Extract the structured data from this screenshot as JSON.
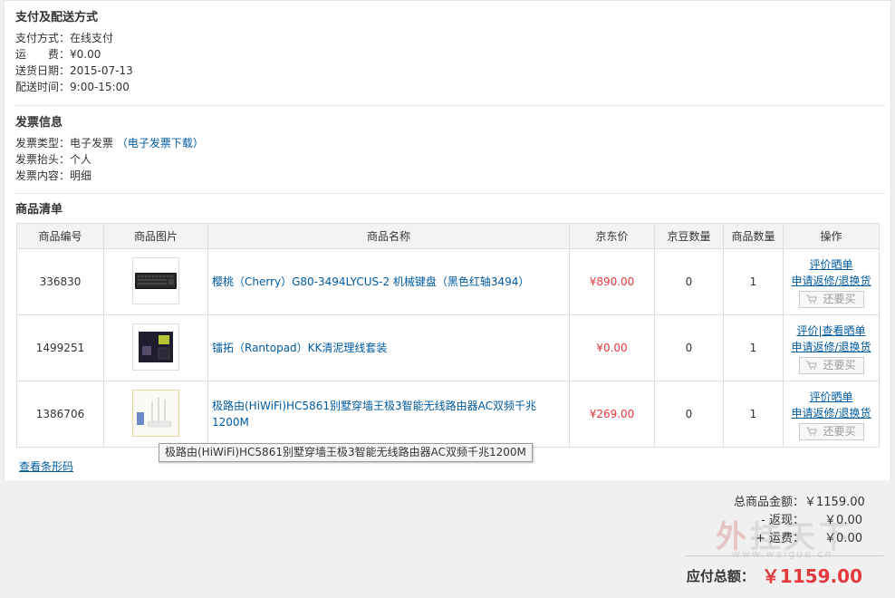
{
  "payment": {
    "title": "支付及配送方式",
    "method_label": "支付方式：",
    "method_value": "在线支付",
    "freight_label": "运　　费：",
    "freight_value": "¥0.00",
    "date_label": "送货日期：",
    "date_value": "2015-07-13",
    "time_label": "配送时间：",
    "time_value": "9:00-15:00"
  },
  "invoice": {
    "title": "发票信息",
    "type_label": "发票类型：",
    "type_value": "电子发票",
    "download_link": "（电子发票下载）",
    "header_label": "发票抬头：",
    "header_value": "个人",
    "content_label": "发票内容：",
    "content_value": "明细"
  },
  "goods": {
    "title": "商品清单",
    "columns": [
      "商品编号",
      "商品图片",
      "商品名称",
      "京东价",
      "京豆数量",
      "商品数量",
      "操作"
    ],
    "rows": [
      {
        "id": "336830",
        "name": "樱桃（Cherry）G80-3494LYCUS-2 机械键盘（黑色红轴3494）",
        "price": "¥890.00",
        "beans": "0",
        "qty": "1",
        "op1": "评价晒单",
        "op2": "申请返修/退换货",
        "buy": "还要买",
        "image": "keyboard-thumbnail"
      },
      {
        "id": "1499251",
        "name": "镭拓（Rantopad）KK清泥理线套装",
        "price": "¥0.00",
        "beans": "0",
        "qty": "1",
        "op1": "评价|查看晒单",
        "op2": "申请返修/退换货",
        "buy": "还要买",
        "image": "cable-kit-thumbnail"
      },
      {
        "id": "1386706",
        "name": "极路由(HiWiFi)HC5861别墅穿墙王极3智能无线路由器AC双频千兆1200M",
        "price": "¥269.00",
        "beans": "0",
        "qty": "1",
        "op1": "评价晒单",
        "op2": "申请返修/退换货",
        "buy": "还要买",
        "image": "router-thumbnail"
      }
    ],
    "tooltip": "极路由(HiWiFi)HC5861别墅穿墙王极3智能无线路由器AC双频千兆1200M",
    "barcode_link": "查看条形码"
  },
  "summary": {
    "goods_total_label": "总商品金额：",
    "goods_total_value": "￥1159.00",
    "rebate_label": "- 返现：",
    "rebate_value": "￥0.00",
    "freight_label": "+ 运费：",
    "freight_value": "￥0.00",
    "payable_label": "应付总额：",
    "payable_value": "￥1159.00"
  },
  "watermark": {
    "text_red": "外",
    "text": "挂天下",
    "url": "www.waigue.cn"
  },
  "colors": {
    "price_red": "#e4393c",
    "link_blue": "#005aa0",
    "header_bg": "#f3f3f3",
    "border": "#dddddd"
  }
}
